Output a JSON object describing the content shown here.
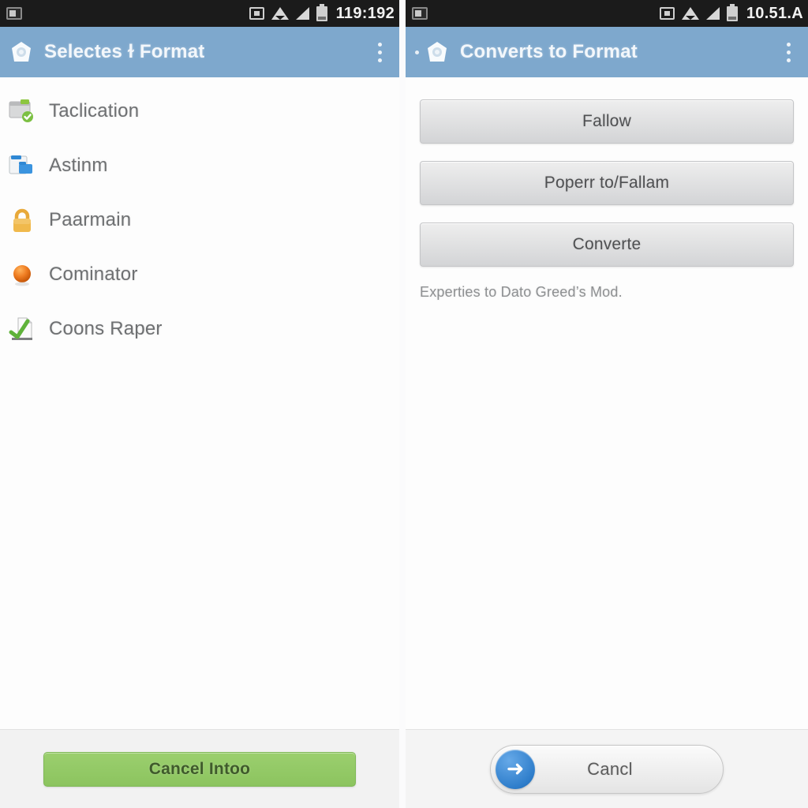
{
  "left_screen": {
    "status_bar": {
      "notification_icon": "screenshot-icon",
      "cast_icon": "cast-icon",
      "wifi_icon": "wifi-icon",
      "signal_icon": "signal-icon",
      "battery_icon": "battery-icon",
      "time": "119:192"
    },
    "app_bar": {
      "logo_icon": "app-home-logo-icon",
      "title": "Selectes ɫ Format",
      "overflow_icon": "overflow-menu-icon"
    },
    "list_items": [
      {
        "icon": "window-check-icon",
        "label": "Taclication"
      },
      {
        "icon": "folder-icon",
        "label": "Astinm"
      },
      {
        "icon": "lock-icon",
        "label": "Paarmain"
      },
      {
        "icon": "orange-sphere-icon",
        "label": "Cominator"
      },
      {
        "icon": "document-check-icon",
        "label": "Coons Raper"
      }
    ],
    "footer": {
      "button_label": "Cancel Intoo",
      "button_color": "#8cc45f"
    }
  },
  "right_screen": {
    "status_bar": {
      "notification_icon": "screenshot-icon",
      "cast_icon": "cast-icon",
      "wifi_icon": "wifi-icon",
      "signal_icon": "signal-icon",
      "battery_icon": "battery-icon",
      "time": "10.51.A"
    },
    "app_bar": {
      "bullet": "",
      "logo_icon": "app-home-logo-icon",
      "title": "Converts to Format",
      "overflow_icon": "overflow-menu-icon"
    },
    "buttons": [
      {
        "label": "Fallow"
      },
      {
        "label": "Poperr to/Fallam"
      },
      {
        "label": "Converte"
      }
    ],
    "helper_text": "Experties to Dato Greed’s Mod.",
    "footer": {
      "icon": "arrow-right-circle-icon",
      "icon_glyph": "➜",
      "button_label": "Cancl"
    }
  },
  "theme": {
    "appbar_color": "#7ea8cd",
    "statusbar_color": "#1b1b1b",
    "accent_green": "#8cc45f",
    "accent_blue": "#2f7ecb",
    "body_bg": "#fdfdfd"
  }
}
